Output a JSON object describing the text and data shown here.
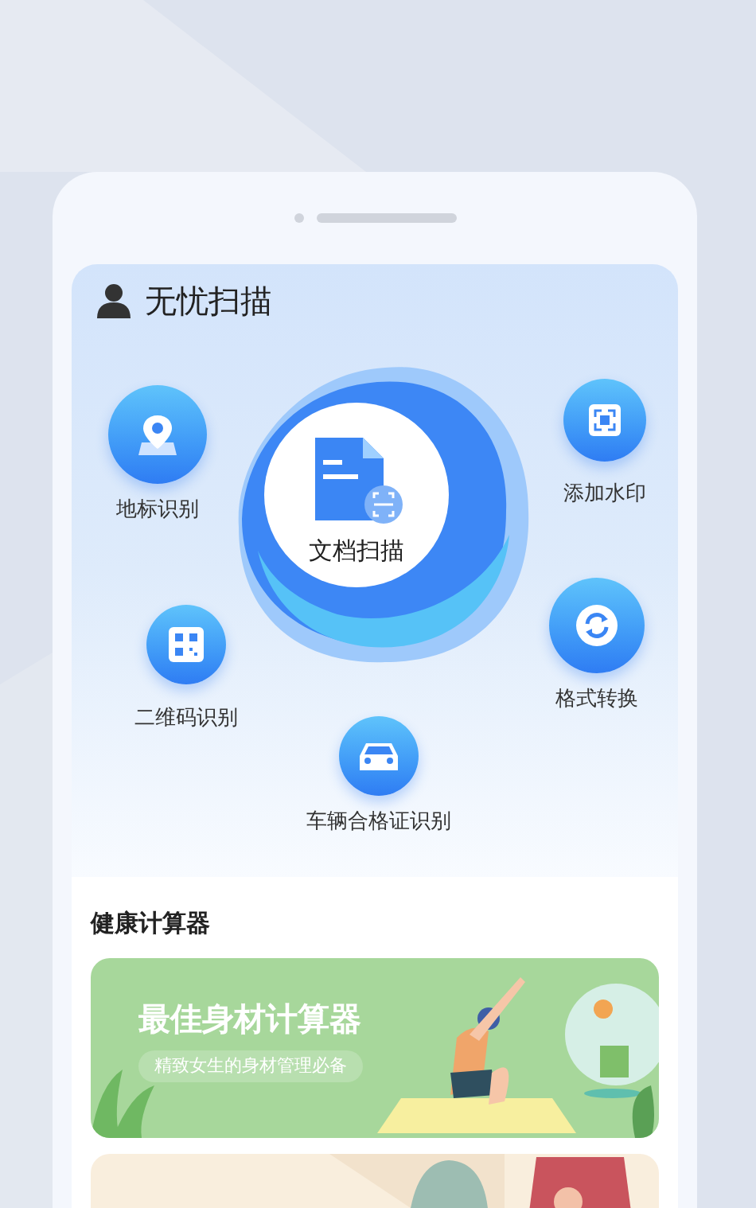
{
  "app_title": "无忧扫描",
  "main_action": {
    "label": "文档扫描"
  },
  "features": [
    {
      "label": "地标识别"
    },
    {
      "label": "添加水印"
    },
    {
      "label": "二维码识别"
    },
    {
      "label": "格式转换"
    },
    {
      "label": "车辆合格证识别"
    }
  ],
  "section_title": "健康计算器",
  "banners": [
    {
      "kind": "promo",
      "title": "最佳身材计算器",
      "subtitle": "精致女生的身材管理必备"
    },
    {
      "kind": "picture"
    }
  ]
}
